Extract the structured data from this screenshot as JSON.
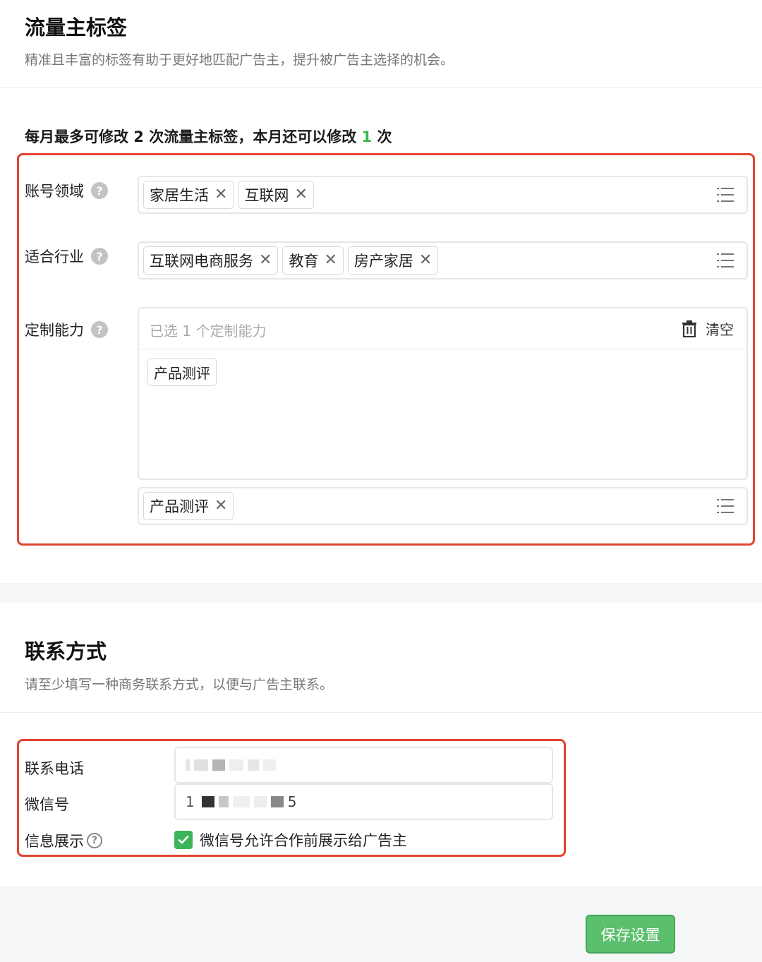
{
  "tags_section": {
    "title": "流量主标签",
    "subtitle": "精准且丰富的标签有助于更好地匹配广告主，提升被广告主选择的机会。",
    "quota_prefix": "每月最多可修改 2 次流量主标签，本月还可以修改 ",
    "quota_count": "1",
    "quota_suffix": " 次",
    "account_domain": {
      "label": "账号领域",
      "tags": [
        "家居生活",
        "互联网"
      ]
    },
    "industry": {
      "label": "适合行业",
      "tags": [
        "互联网电商服务",
        "教育",
        "房产家居"
      ]
    },
    "custom": {
      "label": "定制能力",
      "placeholder": "已选 1 个定制能力",
      "clear_label": "清空",
      "selected": [
        "产品测评"
      ],
      "tags": [
        "产品测评"
      ]
    },
    "help_glyph": "?",
    "remove_glyph": "✕"
  },
  "contact_section": {
    "title": "联系方式",
    "subtitle": "请至少填写一种商务联系方式，以便与广告主联系。",
    "phone": {
      "label": "联系电话"
    },
    "wechat": {
      "label": "微信号",
      "first_char": "1",
      "last_char": "5"
    },
    "display": {
      "label": "信息展示",
      "checkbox_label": "微信号允许合作前展示给广告主",
      "checked": true
    }
  },
  "footer": {
    "save_label": "保存设置"
  },
  "colors": {
    "accent_green": "#3cb55a",
    "highlight_red": "#e2432f",
    "count_green": "#36b84c"
  }
}
